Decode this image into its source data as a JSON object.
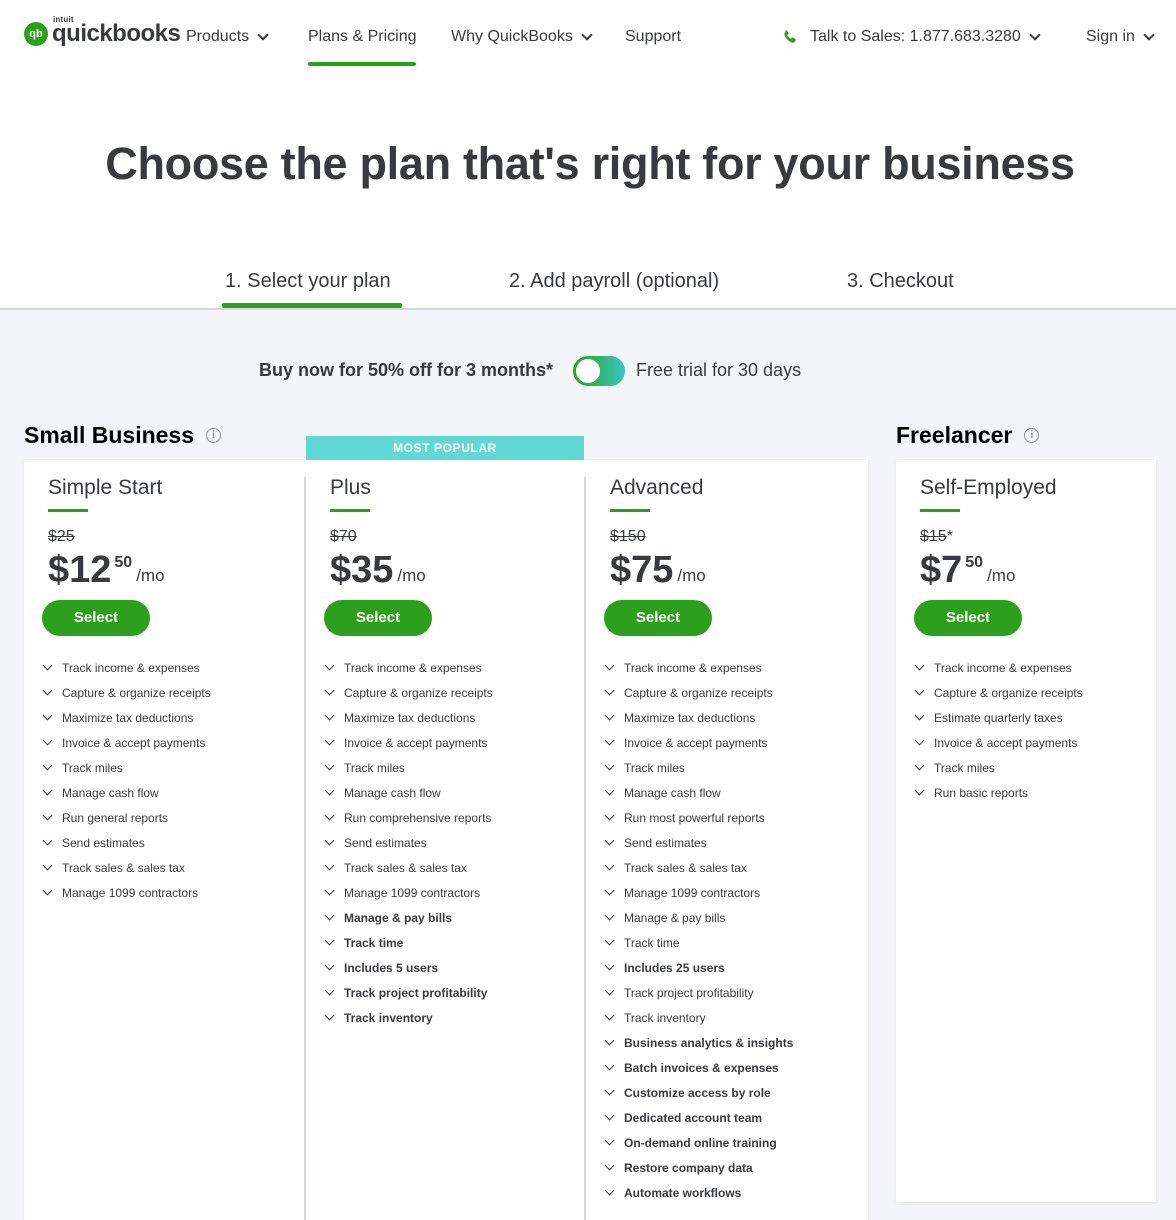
{
  "brand": {
    "badge": "qb",
    "top": "intuit",
    "name": "quickbooks"
  },
  "nav": {
    "products": "Products",
    "plans_pricing": "Plans & Pricing",
    "why": "Why QuickBooks",
    "support": "Support",
    "sales": "Talk to Sales: 1.877.683.3280",
    "sign_in": "Sign in"
  },
  "headline": "Choose the plan that's right for your business",
  "steps": [
    "1. Select your plan",
    "2. Add payroll (optional)",
    "3. Checkout"
  ],
  "offer": {
    "left": "Buy now for 50% off for 3 months*",
    "right": "Free trial for 30 days",
    "toggle_state": "buy-now"
  },
  "sections": {
    "small_business": "Small Business",
    "freelancer": "Freelancer",
    "info_glyph": "i"
  },
  "badge": "MOST POPULAR",
  "select_label": "Select",
  "per_month": "/mo",
  "plans": [
    {
      "name": "Simple Start",
      "old_price": "$25",
      "price": "$12",
      "cents": "50",
      "features": [
        {
          "text": "Track income & expenses",
          "bold": false
        },
        {
          "text": "Capture & organize receipts",
          "bold": false
        },
        {
          "text": "Maximize tax deductions",
          "bold": false
        },
        {
          "text": "Invoice & accept payments",
          "bold": false
        },
        {
          "text": "Track miles",
          "bold": false
        },
        {
          "text": "Manage cash flow",
          "bold": false
        },
        {
          "text": "Run general reports",
          "bold": false
        },
        {
          "text": "Send estimates",
          "bold": false
        },
        {
          "text": "Track sales & sales tax",
          "bold": false
        },
        {
          "text": "Manage 1099 contractors",
          "bold": false
        }
      ]
    },
    {
      "name": "Plus",
      "old_price": "$70",
      "price": "$35",
      "cents": "",
      "features": [
        {
          "text": "Track income & expenses",
          "bold": false
        },
        {
          "text": "Capture & organize receipts",
          "bold": false
        },
        {
          "text": "Maximize tax deductions",
          "bold": false
        },
        {
          "text": "Invoice & accept payments",
          "bold": false
        },
        {
          "text": "Track miles",
          "bold": false
        },
        {
          "text": "Manage cash flow",
          "bold": false
        },
        {
          "text": "Run comprehensive reports",
          "bold": false
        },
        {
          "text": "Send estimates",
          "bold": false
        },
        {
          "text": "Track sales & sales tax",
          "bold": false
        },
        {
          "text": "Manage 1099 contractors",
          "bold": false
        },
        {
          "text": "Manage & pay bills",
          "bold": true
        },
        {
          "text": "Track time",
          "bold": true
        },
        {
          "text": "Includes 5 users",
          "bold": true
        },
        {
          "text": "Track project profitability",
          "bold": true
        },
        {
          "text": "Track inventory",
          "bold": true
        }
      ]
    },
    {
      "name": "Advanced",
      "old_price": "$150",
      "price": "$75",
      "cents": "",
      "features": [
        {
          "text": "Track income & expenses",
          "bold": false
        },
        {
          "text": "Capture & organize receipts",
          "bold": false
        },
        {
          "text": "Maximize tax deductions",
          "bold": false
        },
        {
          "text": "Invoice & accept payments",
          "bold": false
        },
        {
          "text": "Track miles",
          "bold": false
        },
        {
          "text": "Manage cash flow",
          "bold": false
        },
        {
          "text": "Run most powerful reports",
          "bold": false
        },
        {
          "text": "Send estimates",
          "bold": false
        },
        {
          "text": "Track sales & sales tax",
          "bold": false
        },
        {
          "text": "Manage 1099 contractors",
          "bold": false
        },
        {
          "text": "Manage & pay bills",
          "bold": false
        },
        {
          "text": "Track time",
          "bold": false
        },
        {
          "text": "Includes 25 users",
          "bold": true
        },
        {
          "text": "Track project profitability",
          "bold": false
        },
        {
          "text": "Track inventory",
          "bold": false
        },
        {
          "text": "Business analytics & insights",
          "bold": true
        },
        {
          "text": "Batch invoices & expenses",
          "bold": true
        },
        {
          "text": "Customize access by role",
          "bold": true
        },
        {
          "text": "Dedicated account team",
          "bold": true
        },
        {
          "text": "On-demand online training",
          "bold": true
        },
        {
          "text": "Restore company data",
          "bold": true
        },
        {
          "text": "Automate workflows",
          "bold": true
        }
      ]
    },
    {
      "name": "Self-Employed",
      "old_price": "$15",
      "old_suffix": "*",
      "price": "$7",
      "cents": "50",
      "features": [
        {
          "text": "Track income & expenses",
          "bold": false
        },
        {
          "text": "Capture & organize receipts",
          "bold": false
        },
        {
          "text": "Estimate quarterly taxes",
          "bold": false
        },
        {
          "text": "Invoice & accept payments",
          "bold": false
        },
        {
          "text": "Track miles",
          "bold": false
        },
        {
          "text": "Run basic reports",
          "bold": false
        }
      ]
    }
  ],
  "colors": {
    "brand_green": "#2ca01c",
    "badge_teal": "#62d8d6",
    "text": "#393a3d",
    "background": "#f4f5f8"
  }
}
